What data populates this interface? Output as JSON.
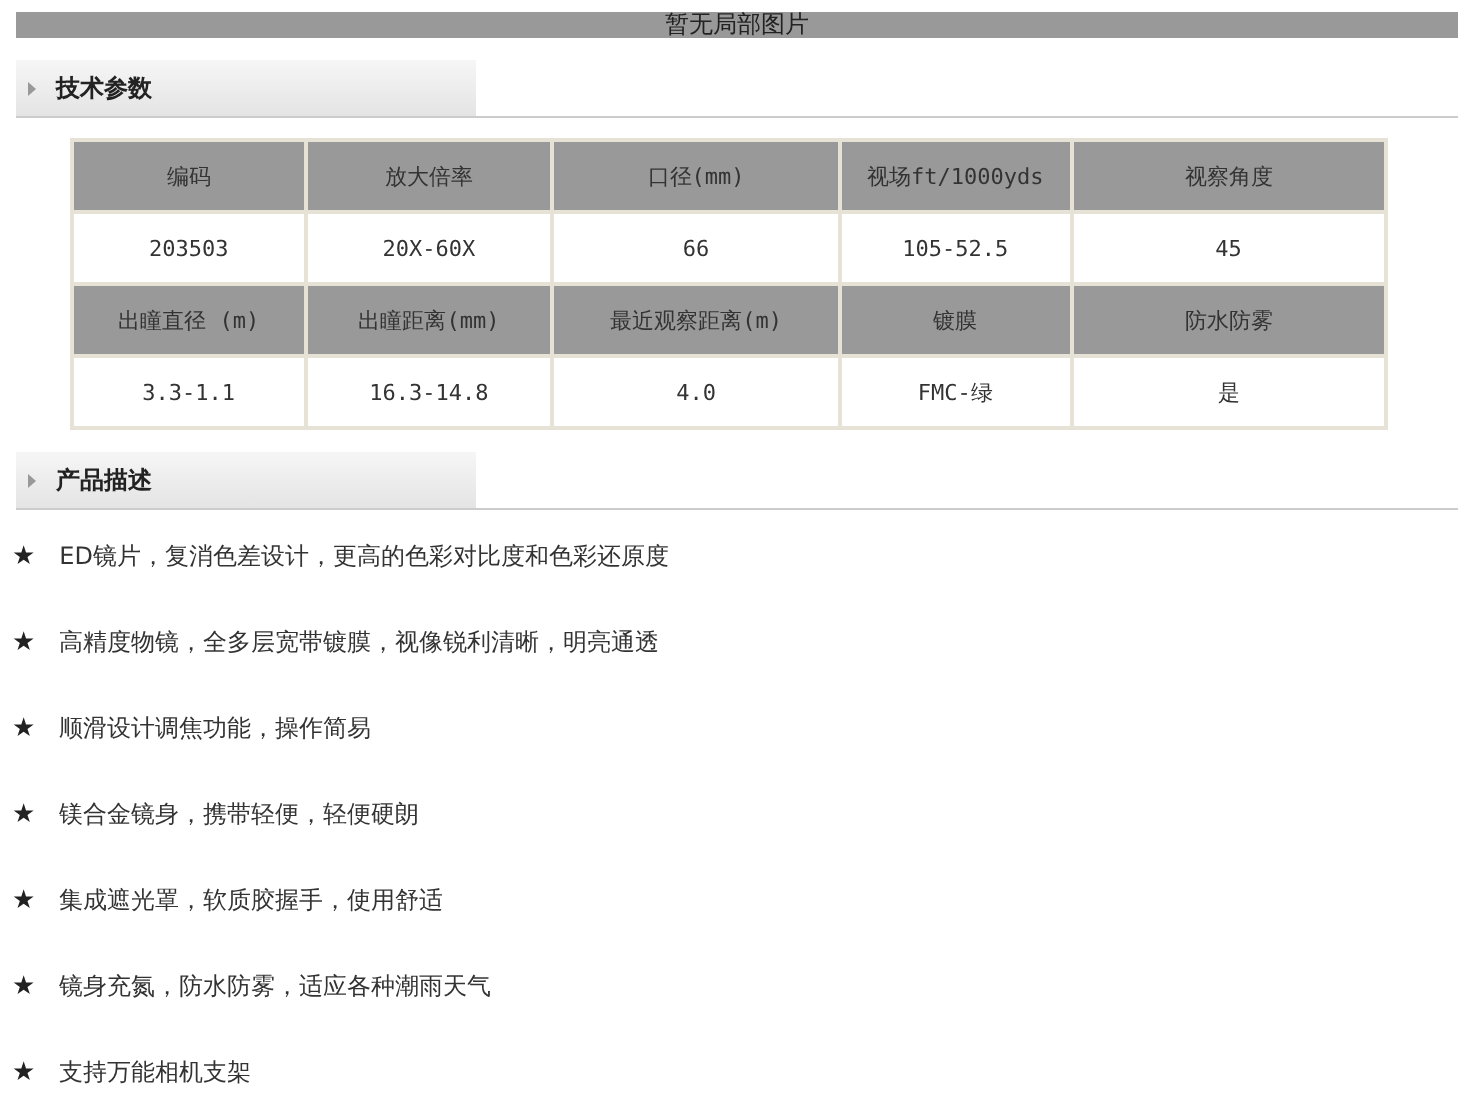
{
  "banner": {
    "text": "暂无局部图片"
  },
  "spec_section": {
    "title": "技术参数"
  },
  "spec_table": {
    "rows": [
      {
        "kind": "header",
        "cells": [
          "编码",
          "放大倍率",
          "口径(mm)",
          "视场ft/1000yds",
          "视察角度"
        ]
      },
      {
        "kind": "data",
        "cells": [
          "203503",
          "20X-60X",
          "66",
          "105-52.5",
          "45"
        ]
      },
      {
        "kind": "header",
        "cells": [
          "出瞳直径 (m)",
          "出瞳距离(mm)",
          "最近观察距离(m)",
          "镀膜",
          "防水防雾"
        ]
      },
      {
        "kind": "data",
        "cells": [
          "3.3-1.1",
          "16.3-14.8",
          "4.0",
          "FMC-绿",
          "是"
        ]
      }
    ]
  },
  "desc_section": {
    "title": "产品描述"
  },
  "features": [
    {
      "bullet": "★",
      "text": "ED镜片，复消色差设计，更高的色彩对比度和色彩还原度"
    },
    {
      "bullet": "★",
      "text": "高精度物镜，全多层宽带镀膜，视像锐利清晰，明亮通透"
    },
    {
      "bullet": "★",
      "text": "顺滑设计调焦功能，操作简易"
    },
    {
      "bullet": "★",
      "text": "镁合金镜身，携带轻便，轻便硬朗"
    },
    {
      "bullet": "★",
      "text": "集成遮光罩，软质胶握手，使用舒适"
    },
    {
      "bullet": "★",
      "text": "镜身充氮，防水防雾，适应各种潮雨天气"
    },
    {
      "bullet": "★",
      "text": "支持万能相机支架"
    }
  ]
}
